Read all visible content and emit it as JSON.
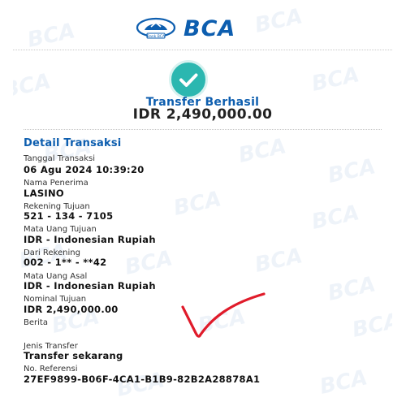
{
  "app": {
    "brand": "BCA",
    "logo_caption": "BCA logo"
  },
  "status": {
    "title": "Transfer Berhasil",
    "amount": "IDR 2,490,000.00",
    "icon": "check-icon",
    "icon_color": "#2bb7b0"
  },
  "details": {
    "section_title": "Detail Transaksi",
    "rows": [
      {
        "label": "Tanggal Transaksi",
        "value": "06 Agu 2024 10:39:20"
      },
      {
        "label": "Nama Penerima",
        "value": "LASINO"
      },
      {
        "label": "Rekening Tujuan",
        "value": "521 - 134 - 7105"
      },
      {
        "label": "Mata Uang Tujuan",
        "value": "IDR - Indonesian Rupiah"
      },
      {
        "label": "Dari Rekening",
        "value": "002 - 1** - **42"
      },
      {
        "label": "Mata Uang Asal",
        "value": "IDR - Indonesian Rupiah"
      },
      {
        "label": "Nominal Tujuan",
        "value": "IDR 2,490,000.00"
      },
      {
        "label": "Berita",
        "value": ""
      },
      {
        "label": "Jenis Transfer",
        "value": "Transfer sekarang"
      },
      {
        "label": "No. Referensi",
        "value": "27EF9899-B06F-4CA1-B1B9-82B2A28878A1"
      }
    ]
  },
  "colors": {
    "brand_blue": "#0d5eaf",
    "accent_teal": "#2bb7b0",
    "signature_red": "#e01b2a"
  }
}
